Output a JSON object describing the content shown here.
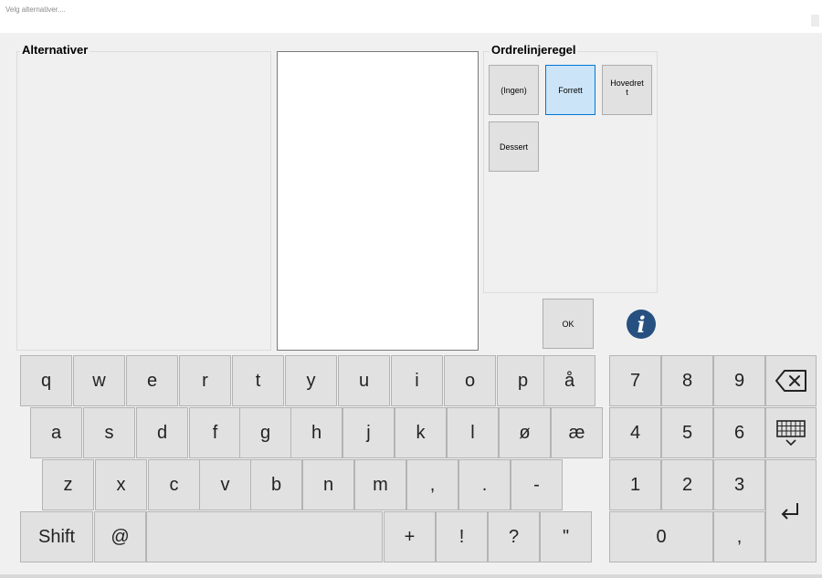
{
  "window": {
    "title": "Velg alternativer...."
  },
  "alternatives": {
    "title": "Alternativer"
  },
  "order_rule": {
    "title": "Ordrelinjeregel",
    "options": [
      {
        "label": "(Ingen)",
        "selected": false
      },
      {
        "label": "Forrett",
        "selected": true
      },
      {
        "label": "Hovedret\nt",
        "selected": false
      },
      {
        "label": "Dessert",
        "selected": false
      }
    ]
  },
  "ok_label": "OK",
  "info_icon": "i",
  "keyboard": {
    "row1": [
      "q",
      "w",
      "e",
      "r",
      "t",
      "y",
      "u",
      "i",
      "o",
      "p",
      "å"
    ],
    "row2": [
      "a",
      "s",
      "d",
      "f",
      "g",
      "h",
      "j",
      "k",
      "l",
      "ø",
      "æ"
    ],
    "row3": [
      "z",
      "x",
      "c",
      "v",
      "b",
      "n",
      "m",
      ",",
      ".",
      "-"
    ],
    "row4": {
      "shift": "Shift",
      "at": "@",
      "space": "",
      "plus": "+",
      "excl": "!",
      "question": "?",
      "quote": "\""
    }
  },
  "numpad": {
    "row1": [
      "7",
      "8",
      "9"
    ],
    "row2": [
      "4",
      "5",
      "6"
    ],
    "row3": [
      "1",
      "2",
      "3"
    ],
    "zero": "0",
    "comma": ","
  },
  "icons": {
    "backspace": "backspace-icon",
    "keyboard": "keyboard-icon",
    "enter": "enter-icon"
  }
}
